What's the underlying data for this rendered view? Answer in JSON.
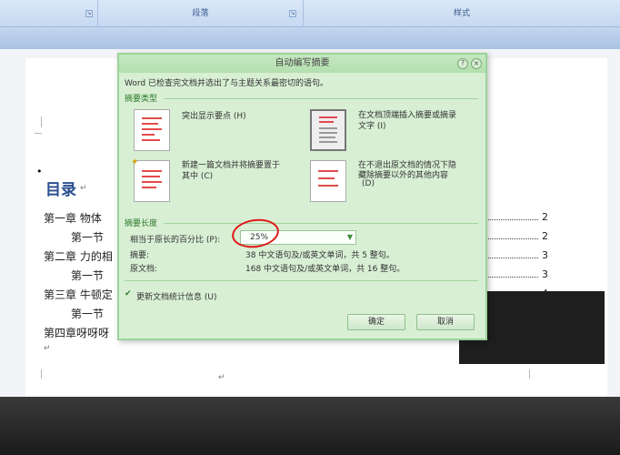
{
  "ribbon": {
    "group_paragraph": "段落",
    "group_style": "样式"
  },
  "toc": {
    "title": "目录",
    "lines": [
      {
        "text": "第一章  物体",
        "page": "2"
      },
      {
        "text": "第一节",
        "page": "2"
      },
      {
        "text": "第二章 力的相",
        "page": "3"
      },
      {
        "text": "第一节",
        "page": "3"
      },
      {
        "text": "第三章 牛顿定",
        "page": "4"
      },
      {
        "text": "第一节",
        "page": ""
      },
      {
        "text": "第四章呀呀呀",
        "page": ""
      }
    ]
  },
  "dialog": {
    "title": "自动编写摘要",
    "intro": "Word 已检查完文档并选出了与主题关系最密切的语句。",
    "section_type": "摘要类型",
    "opt_highlight": "突出显示要点 (H)",
    "opt_insert_top_line1": "在文档顶端插入摘要或摘录",
    "opt_insert_top_line2": "文字 (I)",
    "opt_new_doc_line1": "新建一篇文档并将摘要置于",
    "opt_new_doc_line2": "其中 (C)",
    "opt_hide_line1": "在不退出原文档的情况下隐",
    "opt_hide_line2": "藏除摘要以外的其他内容",
    "opt_hide_line3": "(D)",
    "section_length": "摘要长度",
    "percent_label": "相当于原长的百分比 (P):",
    "percent_value": "25%",
    "summary_label": "摘要:",
    "summary_value": "38 中文语句及/或英文单词，共 5 整句。",
    "original_label": "原文档:",
    "original_value": "168 中文语句及/或英文单词，共 16 整句。",
    "update_stats": "更新文档统计信息 (U)",
    "ok": "确定",
    "cancel": "取消"
  }
}
